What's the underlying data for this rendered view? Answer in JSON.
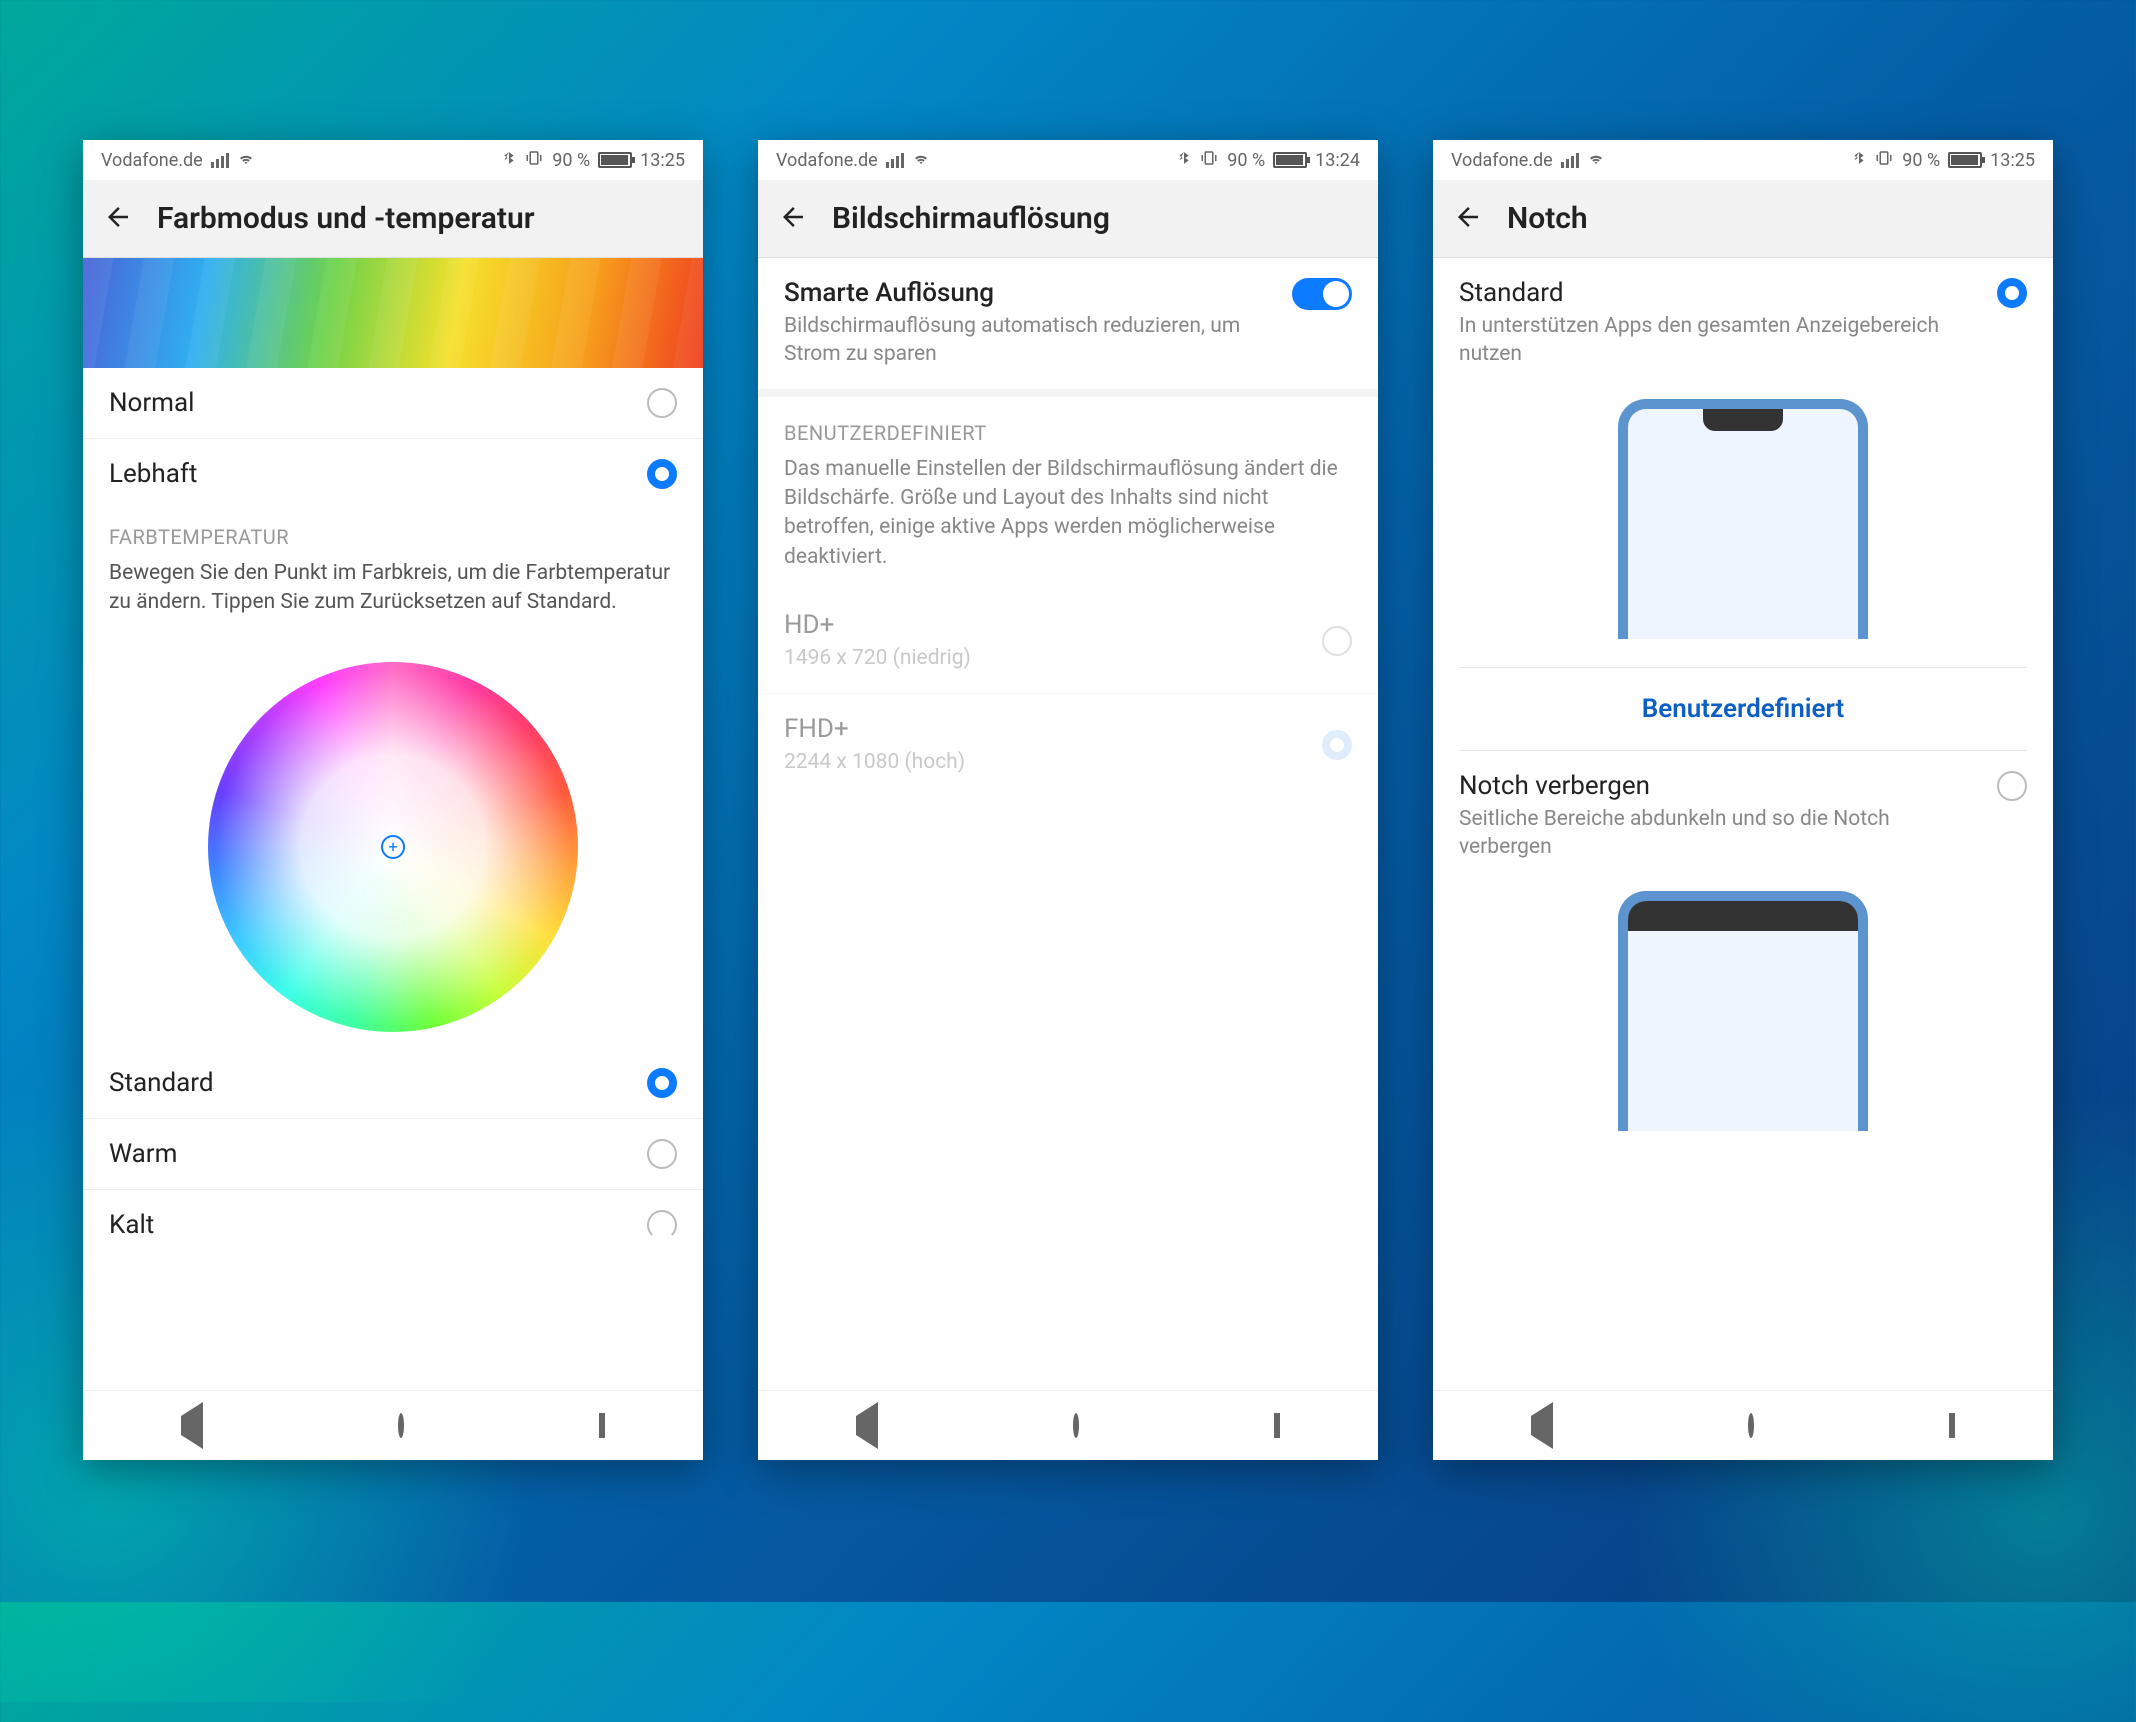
{
  "status": {
    "carrier": "Vodafone.de",
    "battery_pct": "90 %",
    "time_s1": "13:25",
    "time_s2": "13:24",
    "time_s3": "13:25"
  },
  "screen1": {
    "title": "Farbmodus und -temperatur",
    "mode_normal": "Normal",
    "mode_lebhaft": "Lebhaft",
    "section_temp": "FARBTEMPERATUR",
    "temp_desc": "Bewegen Sie den Punkt im Farbkreis, um die Farbtemperatur zu ändern. Tippen Sie zum Zurücksetzen auf Standard.",
    "opt_standard": "Standard",
    "opt_warm": "Warm",
    "opt_kalt": "Kalt"
  },
  "screen2": {
    "title": "Bildschirmauflösung",
    "smart_title": "Smarte Auflösung",
    "smart_desc": "Bildschirmauflösung automatisch reduzieren, um Strom zu sparen",
    "section_custom": "BENUTZERDEFINIERT",
    "custom_desc": "Das manuelle Einstellen der Bildschirmauflösung ändert die Bildschärfe. Größe und Layout des Inhalts sind nicht betroffen, einige aktive Apps werden möglicherweise deaktiviert.",
    "hd_label": "HD+",
    "hd_sub": "1496 x 720 (niedrig)",
    "fhd_label": "FHD+",
    "fhd_sub": "2244 x 1080 (hoch)"
  },
  "screen3": {
    "title": "Notch",
    "std_label": "Standard",
    "std_desc": "In unterstützen Apps den gesamten Anzeigebereich nutzen",
    "custom_link": "Benutzerdefiniert",
    "hide_label": "Notch verbergen",
    "hide_desc": "Seitliche Bereiche abdunkeln und so die Notch verbergen"
  }
}
